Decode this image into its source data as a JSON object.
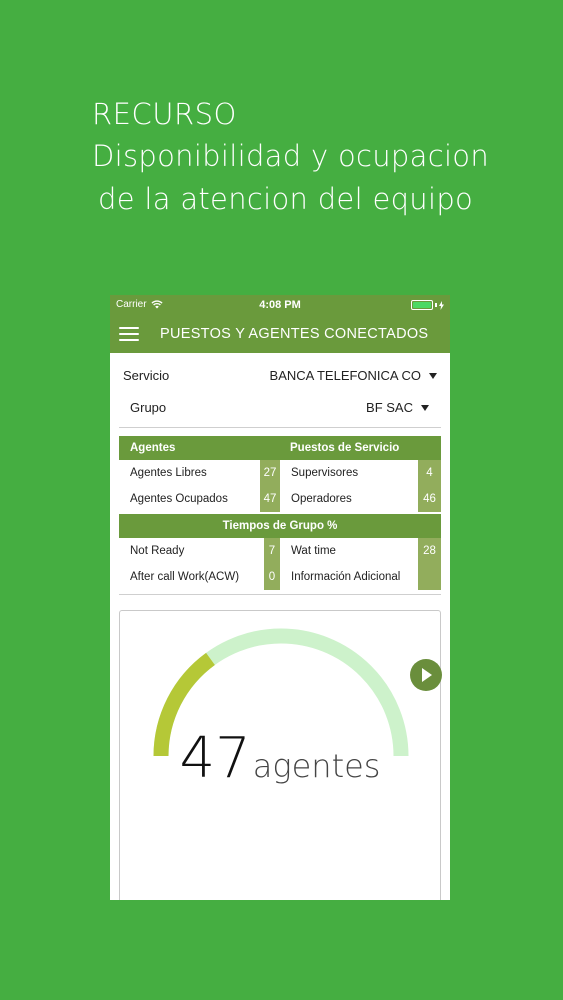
{
  "promo": {
    "line1": "RECURSO",
    "line2": "Disponibilidad y ocupacion",
    "line3": "de la atencion del equipo"
  },
  "status_bar": {
    "carrier": "Carrier",
    "time": "4:08 PM"
  },
  "nav": {
    "title": "PUESTOS Y AGENTES CONECTADOS",
    "menu_icon": "hamburger-icon"
  },
  "filters": {
    "servicio_label": "Servicio",
    "servicio_value": "BANCA TELEFONICA CO",
    "grupo_label": "Grupo",
    "grupo_value": "BF SAC"
  },
  "agentes": {
    "header_left": "Agentes",
    "header_right": "Puestos de Servicio",
    "rows": [
      {
        "left_label": "Agentes Libres",
        "left_value": "27",
        "right_label": "Supervisores",
        "right_value": "4"
      },
      {
        "left_label": "Agentes Ocupados",
        "left_value": "47",
        "right_label": "Operadores",
        "right_value": "46"
      }
    ]
  },
  "tiempos": {
    "header": "Tiempos de Grupo %",
    "rows": [
      {
        "left_label": "Not Ready",
        "left_value": "7",
        "right_label": "Wat time",
        "right_value": "28"
      },
      {
        "left_label": "After call Work(ACW)",
        "left_value": "0",
        "right_label": "Información Adicional",
        "right_value": ""
      }
    ]
  },
  "gauge": {
    "value": "47",
    "unit": "agentes",
    "filled_fraction": 0.3,
    "filled_color": "#b5c837",
    "track_color": "#cdf2cb",
    "next_icon": "play-icon"
  },
  "colors": {
    "background": "#45ae41",
    "brand": "#6a9a3c",
    "value_cell": "#92ad5c"
  }
}
